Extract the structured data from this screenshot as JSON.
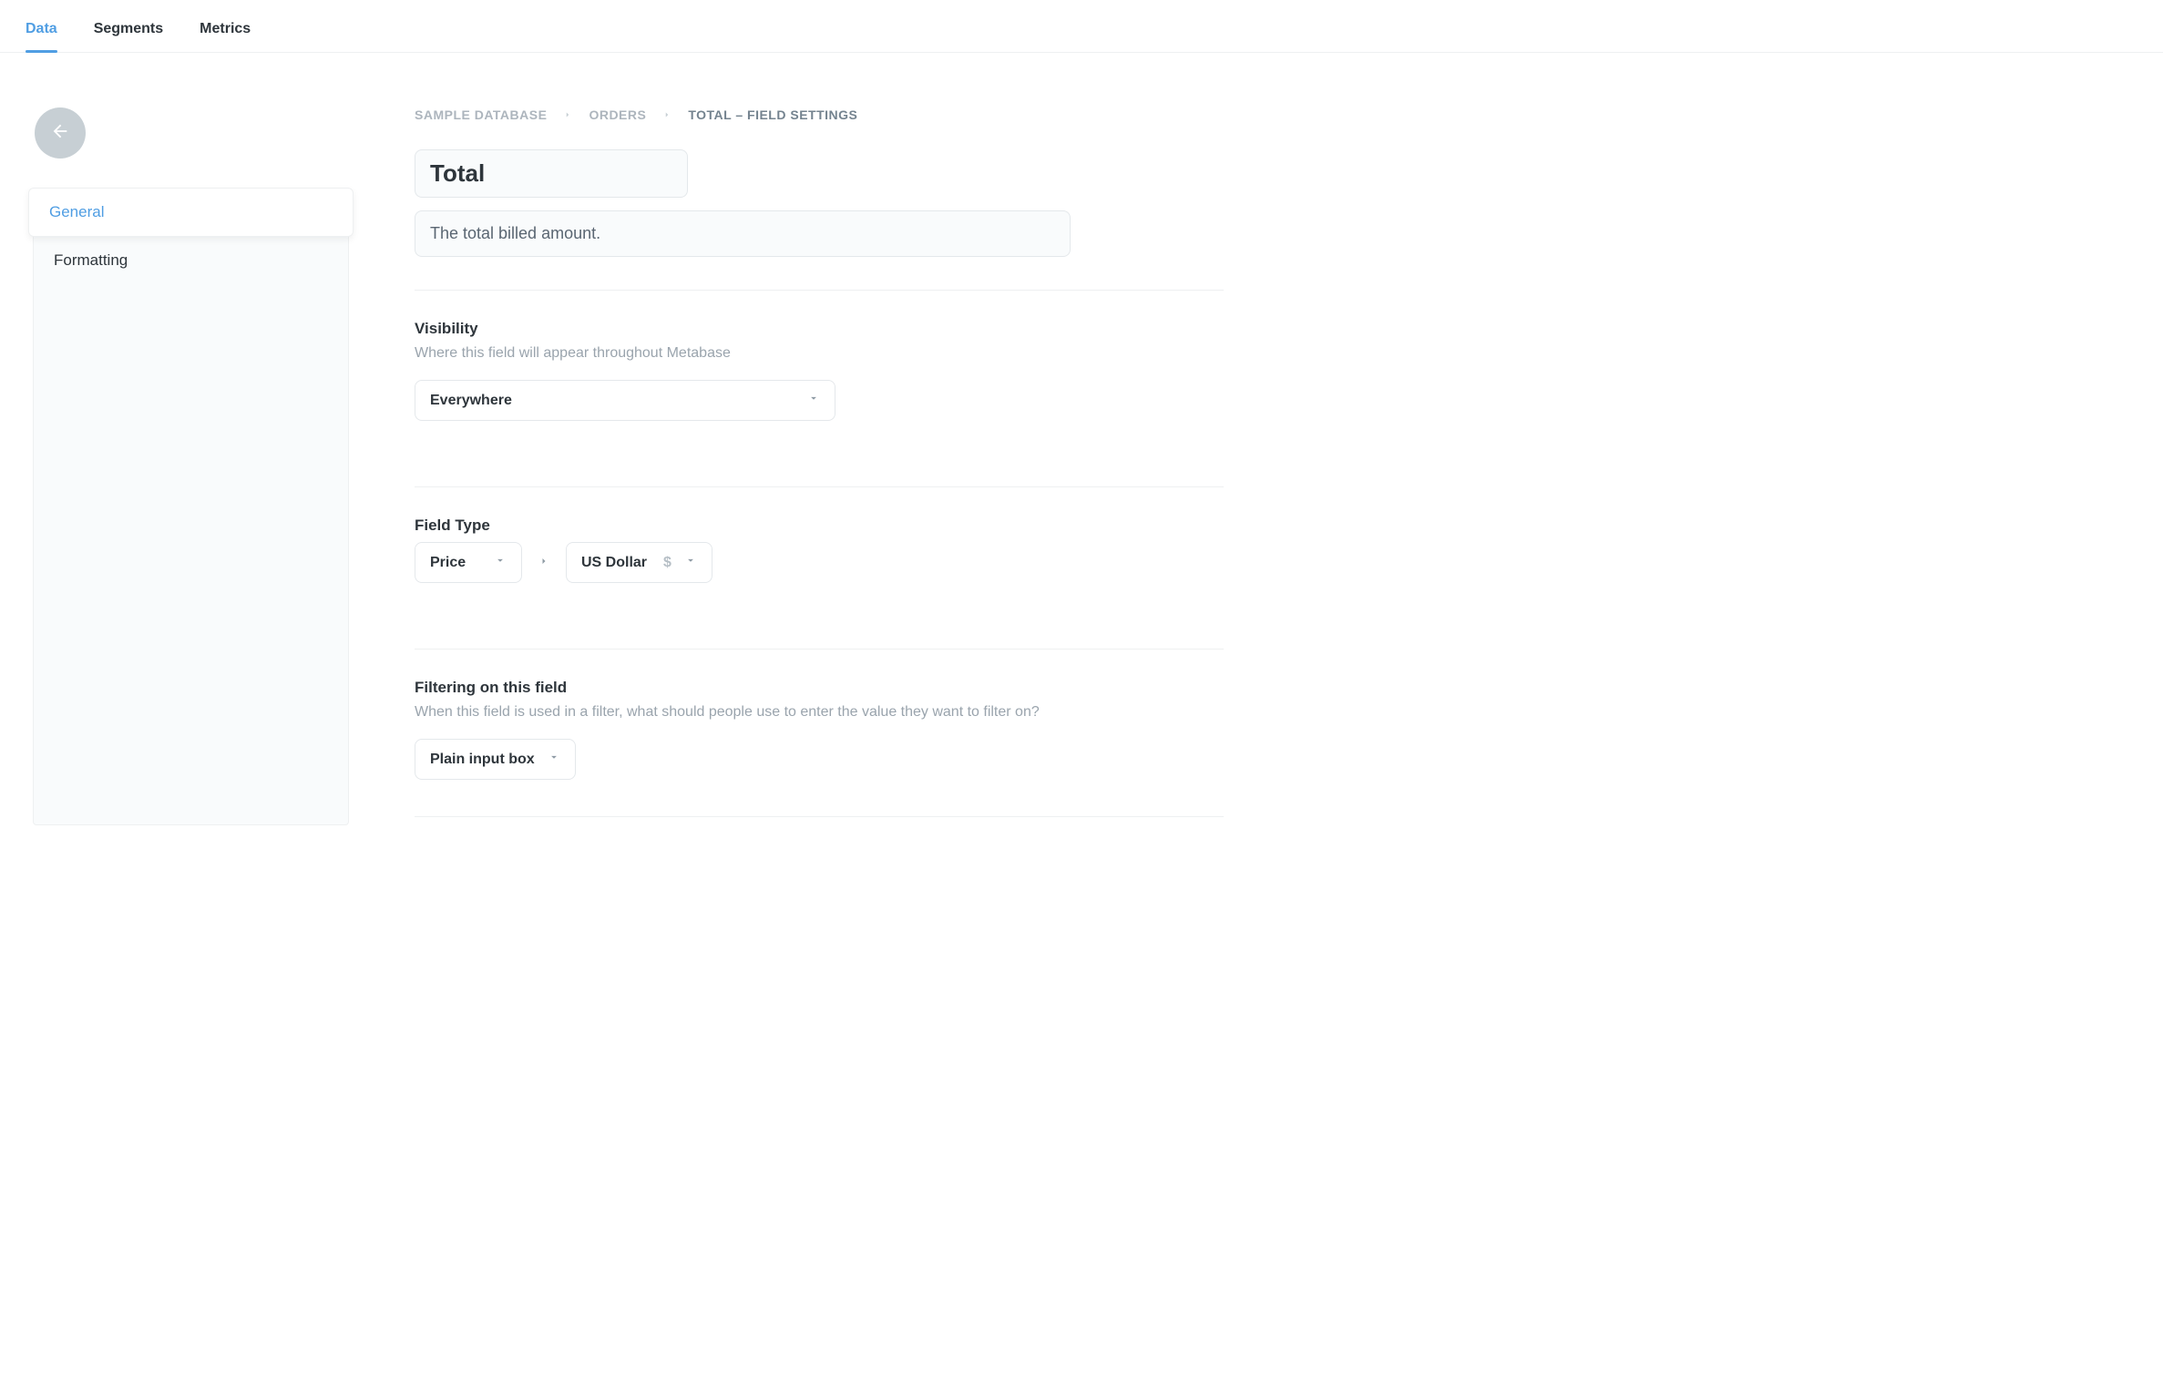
{
  "tabs": {
    "data": "Data",
    "segments": "Segments",
    "metrics": "Metrics"
  },
  "sidebar": {
    "items": [
      {
        "label": "General"
      },
      {
        "label": "Formatting"
      }
    ]
  },
  "breadcrumb": {
    "db": "SAMPLE DATABASE",
    "table": "ORDERS",
    "current": "TOTAL – FIELD SETTINGS"
  },
  "field": {
    "name": "Total",
    "description": "The total billed amount."
  },
  "visibility": {
    "title": "Visibility",
    "hint": "Where this field will appear throughout Metabase",
    "value": "Everywhere"
  },
  "field_type": {
    "title": "Field Type",
    "primary": "Price",
    "secondary": "US Dollar",
    "currency_symbol": "$"
  },
  "filtering": {
    "title": "Filtering on this field",
    "hint": "When this field is used in a filter, what should people use to enter the value they want to filter on?",
    "value": "Plain input box"
  }
}
